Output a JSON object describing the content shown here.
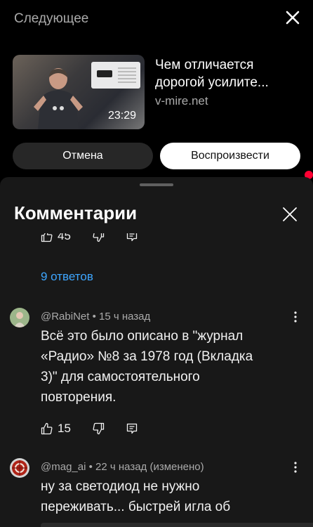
{
  "up_next": {
    "heading": "Следующее",
    "video": {
      "title_lines": [
        "Чем отличается",
        "дорогой усилите..."
      ],
      "channel": "v-mire.net",
      "duration": "23:29"
    },
    "cancel_label": "Отмена",
    "play_label": "Воспроизвести"
  },
  "comments_panel": {
    "title": "Комментарии",
    "previous_comment": {
      "likes": "45"
    },
    "replies_link": "9 ответов",
    "comments": [
      {
        "author": "@RabiNet",
        "time": "15 ч назад",
        "text_lines": [
          "Всё это было описано в \"журнал",
          "«Радио» №8 за 1978 год (Вкладка",
          "3)\" для самостоятельного",
          "повторения."
        ],
        "likes": "15"
      },
      {
        "author": "@mag_ai",
        "time": "22 ч назад (изменено)",
        "text_lines": [
          "ну за светодиод не нужно",
          "переживать... быстрей игла об"
        ]
      }
    ]
  },
  "colors": {
    "background": "#000000",
    "sheet": "#181818",
    "link": "#3ea6ff",
    "notification_dot": "#ff0033"
  },
  "icons": [
    "close-icon",
    "thumb-up-icon",
    "thumb-down-icon",
    "reply-icon",
    "more-vert-icon"
  ]
}
